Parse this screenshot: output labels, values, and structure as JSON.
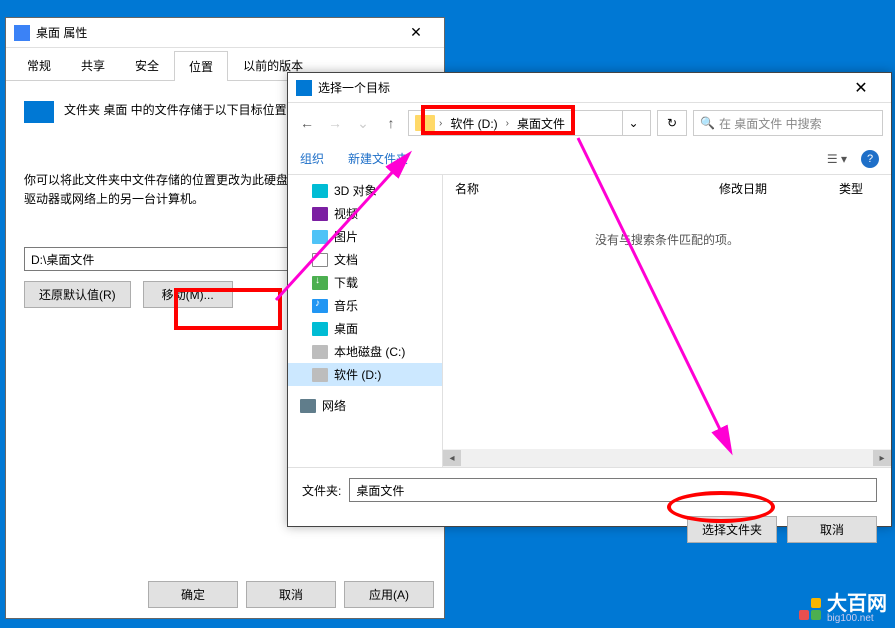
{
  "props": {
    "title": "桌面 属性",
    "tabs": [
      "常规",
      "共享",
      "安全",
      "位置",
      "以前的版本"
    ],
    "active_tab": 3,
    "desc": "文件夹 桌面 中的文件存储于以下目标位置",
    "para": "你可以将此文件夹中文件存储的位置更改为此硬盘上的另一个位置、另一个驱动器或网络上的另一台计算机。",
    "path_value": "D:\\桌面文件",
    "restore_btn": "还原默认值(R)",
    "move_btn": "移动(M)...",
    "ok_btn": "确定",
    "cancel_btn": "取消",
    "apply_btn": "应用(A)"
  },
  "folder": {
    "title": "选择一个目标",
    "addr": {
      "drive": "软件 (D:)",
      "folder": "桌面文件"
    },
    "search_placeholder": "在 桌面文件 中搜索",
    "toolbar": {
      "organize": "组织",
      "new_folder": "新建文件夹"
    },
    "tree": [
      {
        "label": "3D 对象",
        "icon": "3d"
      },
      {
        "label": "视频",
        "icon": "video"
      },
      {
        "label": "图片",
        "icon": "pic"
      },
      {
        "label": "文档",
        "icon": "doc"
      },
      {
        "label": "下载",
        "icon": "dl"
      },
      {
        "label": "音乐",
        "icon": "music"
      },
      {
        "label": "桌面",
        "icon": "desk"
      },
      {
        "label": "本地磁盘 (C:)",
        "icon": "disk"
      },
      {
        "label": "软件 (D:)",
        "icon": "disk",
        "selected": true
      }
    ],
    "network": "网络",
    "columns": {
      "name": "名称",
      "date": "修改日期",
      "type": "类型"
    },
    "empty_msg": "没有与搜索条件匹配的项。",
    "fname_label": "文件夹:",
    "fname_value": "桌面文件",
    "select_btn": "选择文件夹",
    "cancel_btn": "取消"
  },
  "watermark": {
    "title": "大百网",
    "sub": "big100.net"
  }
}
